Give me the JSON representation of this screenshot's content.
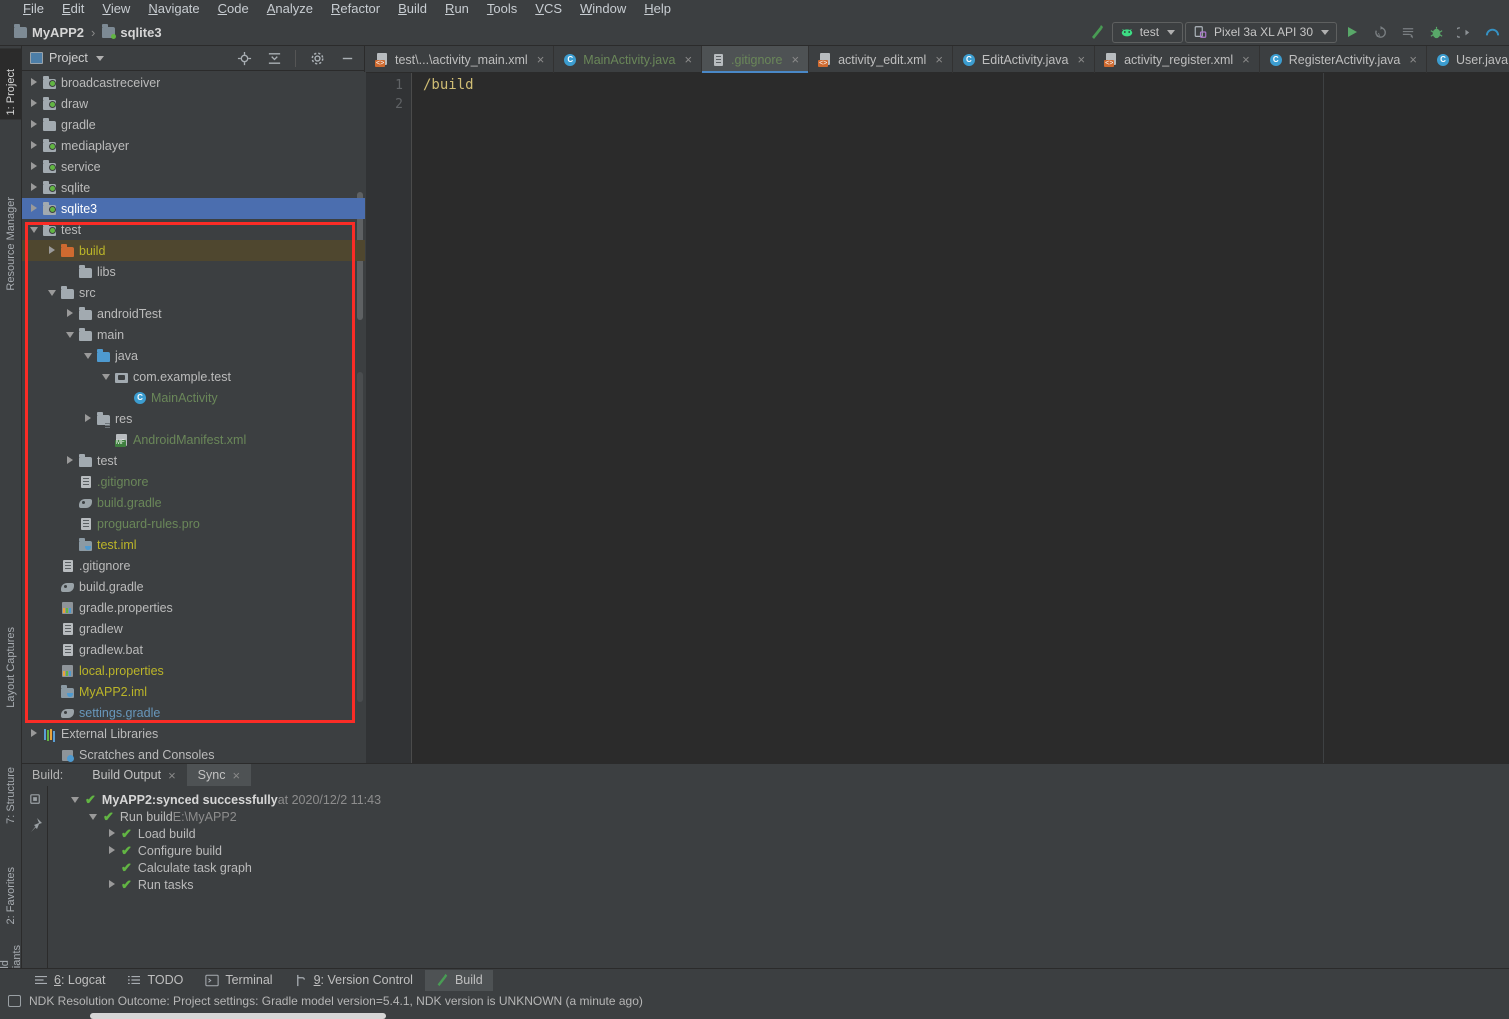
{
  "menu": {
    "items": [
      "File",
      "Edit",
      "View",
      "Navigate",
      "Code",
      "Analyze",
      "Refactor",
      "Build",
      "Run",
      "Tools",
      "VCS",
      "Window",
      "Help"
    ]
  },
  "breadcrumb": {
    "project": "MyAPP2",
    "separator": "›",
    "module": "sqlite3"
  },
  "toolbar": {
    "run_config": "test",
    "device": "Pixel 3a XL API 30",
    "icons": [
      "make-project-icon",
      "run-icon",
      "apply-changes-icon",
      "apply-code-changes-icon",
      "debug-icon",
      "attach-debugger-icon",
      "profiler-icon"
    ]
  },
  "left_strip": {
    "tabs": [
      {
        "label": "1: Project",
        "icon": "project-icon",
        "active": true
      },
      {
        "label": "Resource Manager",
        "icon": "resource-manager-icon",
        "active": false
      },
      {
        "label": "Layout Captures",
        "icon": "layout-captures-icon",
        "active": false
      },
      {
        "label": "7: Structure",
        "icon": "structure-icon",
        "active": false
      },
      {
        "label": "2: Favorites",
        "icon": "favorites-star-icon",
        "active": false
      },
      {
        "label": "Build Variants",
        "icon": "build-variants-icon",
        "active": false
      }
    ]
  },
  "project_panel": {
    "title": "Project",
    "tools": [
      "locate-target-icon",
      "collapse-all-icon",
      "settings-gear-icon",
      "hide-minimize-icon"
    ],
    "tree": [
      {
        "label": "broadcastreceiver",
        "indent": 1,
        "arrow": "right",
        "icon": "folder-module",
        "color": "white"
      },
      {
        "label": "draw",
        "indent": 1,
        "arrow": "right",
        "icon": "folder-module",
        "color": "white"
      },
      {
        "label": "gradle",
        "indent": 1,
        "arrow": "right",
        "icon": "folder",
        "color": "white"
      },
      {
        "label": "mediaplayer",
        "indent": 1,
        "arrow": "right",
        "icon": "folder-module",
        "color": "white"
      },
      {
        "label": "service",
        "indent": 1,
        "arrow": "right",
        "icon": "folder-module",
        "color": "white"
      },
      {
        "label": "sqlite",
        "indent": 1,
        "arrow": "right",
        "icon": "folder-module",
        "color": "white"
      },
      {
        "label": "sqlite3",
        "indent": 1,
        "arrow": "right",
        "icon": "folder-module",
        "color": "white",
        "state": "selected"
      },
      {
        "label": "test",
        "indent": 1,
        "arrow": "down",
        "icon": "folder-module",
        "color": "white"
      },
      {
        "label": "build",
        "indent": 2,
        "arrow": "right",
        "icon": "folder-orange",
        "color": "orange",
        "state": "highlight"
      },
      {
        "label": "libs",
        "indent": 3,
        "arrow": "none",
        "icon": "folder",
        "color": "white"
      },
      {
        "label": "src",
        "indent": 2,
        "arrow": "down",
        "icon": "folder",
        "color": "white"
      },
      {
        "label": "androidTest",
        "indent": 3,
        "arrow": "right",
        "icon": "folder",
        "color": "white"
      },
      {
        "label": "main",
        "indent": 3,
        "arrow": "down",
        "icon": "folder",
        "color": "white"
      },
      {
        "label": "java",
        "indent": 4,
        "arrow": "down",
        "icon": "folder-blue",
        "color": "white"
      },
      {
        "label": "com.example.test",
        "indent": 5,
        "arrow": "down",
        "icon": "package",
        "color": "white"
      },
      {
        "label": "MainActivity",
        "indent": 6,
        "arrow": "none",
        "icon": "java-class",
        "color": "green"
      },
      {
        "label": "res",
        "indent": 4,
        "arrow": "right",
        "icon": "folder-res",
        "color": "white"
      },
      {
        "label": "AndroidManifest.xml",
        "indent": 5,
        "arrow": "none",
        "icon": "manifest",
        "color": "green"
      },
      {
        "label": "test",
        "indent": 3,
        "arrow": "right",
        "icon": "folder",
        "color": "white"
      },
      {
        "label": ".gitignore",
        "indent": 3,
        "arrow": "none",
        "icon": "text-file",
        "color": "green"
      },
      {
        "label": "build.gradle",
        "indent": 3,
        "arrow": "none",
        "icon": "gradle-file",
        "color": "green"
      },
      {
        "label": "proguard-rules.pro",
        "indent": 3,
        "arrow": "none",
        "icon": "text-file",
        "color": "green"
      },
      {
        "label": "test.iml",
        "indent": 3,
        "arrow": "none",
        "icon": "iml-file",
        "color": "orange"
      },
      {
        "label": ".gitignore",
        "indent": 2,
        "arrow": "none",
        "icon": "text-file",
        "color": "white"
      },
      {
        "label": "build.gradle",
        "indent": 2,
        "arrow": "none",
        "icon": "gradle-file",
        "color": "white"
      },
      {
        "label": "gradle.properties",
        "indent": 2,
        "arrow": "none",
        "icon": "properties-file",
        "color": "white"
      },
      {
        "label": "gradlew",
        "indent": 2,
        "arrow": "none",
        "icon": "text-file",
        "color": "white"
      },
      {
        "label": "gradlew.bat",
        "indent": 2,
        "arrow": "none",
        "icon": "text-file",
        "color": "white"
      },
      {
        "label": "local.properties",
        "indent": 2,
        "arrow": "none",
        "icon": "properties-file",
        "color": "orange"
      },
      {
        "label": "MyAPP2.iml",
        "indent": 2,
        "arrow": "none",
        "icon": "iml-file",
        "color": "orange"
      },
      {
        "label": "settings.gradle",
        "indent": 2,
        "arrow": "none",
        "icon": "gradle-file",
        "color": "blue"
      },
      {
        "label": "External Libraries",
        "indent": 1,
        "arrow": "right",
        "icon": "library",
        "color": "white"
      },
      {
        "label": "Scratches and Consoles",
        "indent": 2,
        "arrow": "none",
        "icon": "scratches",
        "color": "white"
      }
    ]
  },
  "editor": {
    "tabs": [
      {
        "label": "test\\...\\activity_main.xml",
        "icon": "xml-file-icon",
        "active": false,
        "color": "normal"
      },
      {
        "label": "MainActivity.java",
        "icon": "java-class-icon",
        "active": false,
        "color": "green"
      },
      {
        "label": ".gitignore",
        "icon": "text-file-icon",
        "active": true,
        "color": "green"
      },
      {
        "label": "activity_edit.xml",
        "icon": "xml-file-icon",
        "active": false,
        "color": "normal"
      },
      {
        "label": "EditActivity.java",
        "icon": "java-class-icon",
        "active": false,
        "color": "normal"
      },
      {
        "label": "activity_register.xml",
        "icon": "xml-file-icon",
        "active": false,
        "color": "normal"
      },
      {
        "label": "RegisterActivity.java",
        "icon": "java-class-icon",
        "active": false,
        "color": "normal"
      },
      {
        "label": "User.java",
        "icon": "java-class-icon",
        "active": false,
        "color": "normal"
      }
    ],
    "close_glyph": "×",
    "line_numbers": [
      "1",
      "2"
    ],
    "lines": [
      "/build",
      ""
    ]
  },
  "build_panel": {
    "label": "Build:",
    "tabs": [
      {
        "label": "Build Output",
        "active": false
      },
      {
        "label": "Sync",
        "active": true
      }
    ],
    "close_glyph": "×",
    "check_glyph": "✔",
    "rows": [
      {
        "indent": 0,
        "arrow": "down",
        "title": "MyAPP2:",
        "text": " synced successfully",
        "suffix": " at 2020/12/2 11:43",
        "bold": true
      },
      {
        "indent": 1,
        "arrow": "down",
        "title": "",
        "text": "Run build",
        "suffix": " E:\\MyAPP2",
        "bold": false
      },
      {
        "indent": 2,
        "arrow": "right",
        "title": "",
        "text": "Load build",
        "suffix": "",
        "bold": false
      },
      {
        "indent": 2,
        "arrow": "right",
        "title": "",
        "text": "Configure build",
        "suffix": "",
        "bold": false
      },
      {
        "indent": 2,
        "arrow": "none",
        "title": "",
        "text": "Calculate task graph",
        "suffix": "",
        "bold": false
      },
      {
        "indent": 2,
        "arrow": "right",
        "title": "",
        "text": "Run tasks",
        "suffix": "",
        "bold": false
      }
    ],
    "side_icons": [
      "restart-sync-icon",
      "pin-icon"
    ]
  },
  "bottom_bar": {
    "tabs": [
      {
        "label": "6: Logcat",
        "mnemonic": "6",
        "icon": "logcat-icon",
        "active": false
      },
      {
        "label": "TODO",
        "mnemonic": "",
        "icon": "todo-icon",
        "active": false
      },
      {
        "label": "Terminal",
        "mnemonic": "",
        "icon": "terminal-icon",
        "active": false
      },
      {
        "label": "9: Version Control",
        "mnemonic": "9",
        "icon": "vcs-branch-icon",
        "active": false
      },
      {
        "label": "Build",
        "mnemonic": "",
        "icon": "build-hammer-icon",
        "active": true
      }
    ]
  },
  "status_bar": {
    "icon": "event-log-icon",
    "message": "NDK Resolution Outcome: Project settings: Gradle model version=5.4.1, NDK version is UNKNOWN (a minute ago)"
  },
  "colors": {
    "background": "#3c3f41",
    "editor_background": "#2b2b2b",
    "selection_blue": "#4b6eaf",
    "highlight_brown": "#4f472f",
    "green_text": "#6a8759",
    "orange_text": "#bbb529",
    "blue_text": "#6897bb",
    "annotation_red": "#fb2c26",
    "accent_teal": "#4a88c7",
    "check_green": "#62b543"
  }
}
